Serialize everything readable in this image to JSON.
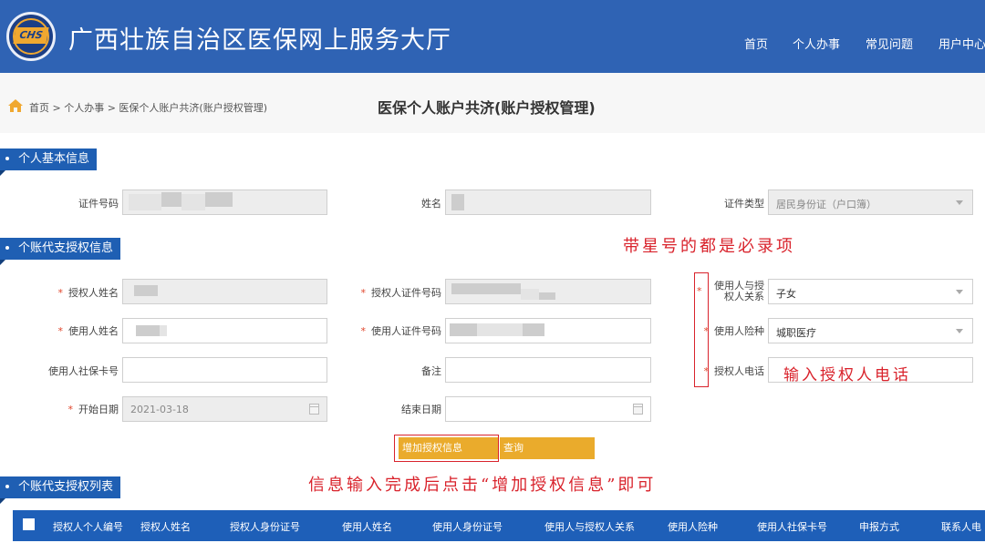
{
  "header": {
    "logo_text": "CHS",
    "title": "广西壮族自治区医保网上服务大厅",
    "nav": [
      "首页",
      "个人办事",
      "常见问题",
      "用户中心"
    ]
  },
  "breadcrumb": {
    "path": "首页 > 个人办事 > 医保个人账户共济(账户授权管理)",
    "page_title": "医保个人账户共济(账户授权管理)"
  },
  "sections": {
    "basic": "个人基本信息",
    "authorize": "个账代支授权信息",
    "list": "个账代支授权列表"
  },
  "basic_info": {
    "id_label": "证件号码",
    "name_label": "姓名",
    "id_type_label": "证件类型",
    "id_type_value": "居民身份证（户口簿）"
  },
  "auth_form": {
    "grantor_name_label": "授权人姓名",
    "grantor_id_label": "授权人证件号码",
    "relation_label": "使用人与授权人关系",
    "relation_value": "子女",
    "user_name_label": "使用人姓名",
    "user_id_label": "使用人证件号码",
    "insurance_label": "使用人险种",
    "insurance_value": "城职医疗",
    "card_label": "使用人社保卡号",
    "remark_label": "备注",
    "phone_label": "授权人电话",
    "start_label": "开始日期",
    "start_value": "2021-03-18",
    "end_label": "结束日期",
    "required_mark": "*"
  },
  "buttons": {
    "add": "增加授权信息",
    "query": "查询"
  },
  "annotations": {
    "required_note": "带星号的都是必录项",
    "phone_note": "输入授权人电话",
    "finish_note": "信息输入完成后点击“增加授权信息”即可"
  },
  "table": {
    "columns": [
      "授权人个人编号",
      "授权人姓名",
      "授权人身份证号",
      "使用人姓名",
      "使用人身份证号",
      "使用人与授权人关系",
      "使用人险种",
      "使用人社保卡号",
      "申报方式",
      "联系人电"
    ]
  },
  "colors": {
    "header_bg": "#2f63b4",
    "section_bg": "#1f5fb3",
    "button_bg": "#eaab2c",
    "annotation_red": "#d9232c"
  }
}
